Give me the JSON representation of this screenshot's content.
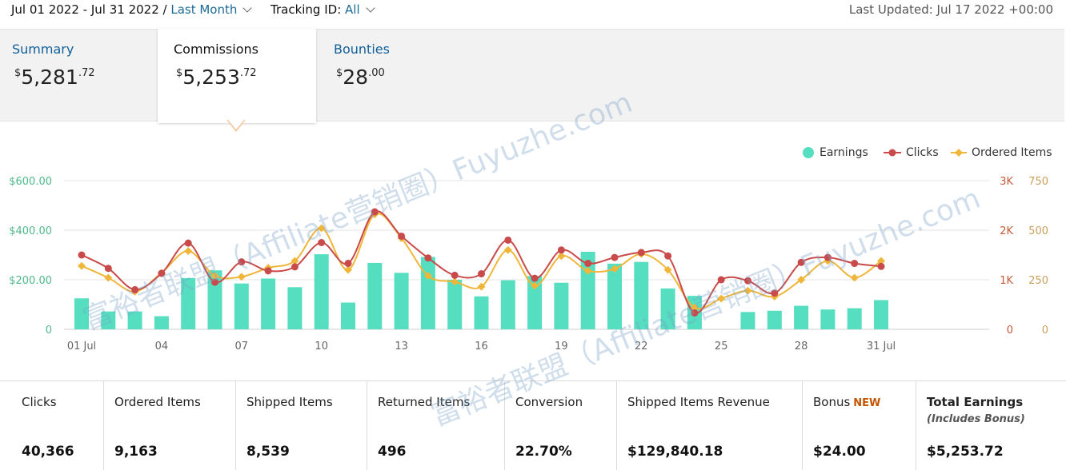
{
  "header": {
    "date_range": "Jul 01 2022 - Jul 31 2022 /",
    "period": "Last Month",
    "tracking_label": "Tracking ID:",
    "tracking_value": "All",
    "last_updated": "Last Updated: Jul 17 2022 +00:00"
  },
  "tabs": [
    {
      "name": "Summary",
      "currency": "$",
      "whole": "5,281",
      "cents": ".72"
    },
    {
      "name": "Commissions",
      "currency": "$",
      "whole": "5,253",
      "cents": ".72"
    },
    {
      "name": "Bounties",
      "currency": "$",
      "whole": "28",
      "cents": ".00"
    }
  ],
  "legend": {
    "earnings": "Earnings",
    "clicks": "Clicks",
    "ordered": "Ordered Items"
  },
  "colors": {
    "earnings": "#55dfc0",
    "clicks": "#c94a4a",
    "ordered": "#f0b63a",
    "axis_left": "#4fb98a",
    "axis_right1": "#c45a3a",
    "axis_right2": "#c9a060"
  },
  "chart_data": {
    "type": "bar",
    "x": [
      1,
      2,
      3,
      4,
      5,
      6,
      7,
      8,
      9,
      10,
      11,
      12,
      13,
      14,
      15,
      16,
      17,
      18,
      19,
      20,
      21,
      22,
      23,
      24,
      25,
      26,
      27,
      28,
      29,
      30,
      31
    ],
    "xtick_labels": [
      "01 Jul",
      "04",
      "07",
      "10",
      "13",
      "16",
      "19",
      "22",
      "25",
      "28",
      "31 Jul"
    ],
    "xtick_positions": [
      1,
      4,
      7,
      10,
      13,
      16,
      19,
      22,
      25,
      28,
      31
    ],
    "series": [
      {
        "name": "Earnings",
        "axis": "left",
        "type": "bar",
        "values": [
          125,
          72,
          72,
          53,
          207,
          238,
          185,
          205,
          170,
          303,
          108,
          268,
          228,
          292,
          200,
          133,
          198,
          215,
          188,
          313,
          265,
          272,
          165,
          135,
          0,
          70,
          75,
          95,
          80,
          85,
          118
        ]
      },
      {
        "name": "Clicks",
        "axis": "right1",
        "type": "line",
        "values": [
          1500,
          1230,
          800,
          1130,
          1740,
          950,
          1360,
          1180,
          1260,
          1750,
          1330,
          2370,
          1880,
          1440,
          1090,
          1120,
          1800,
          1030,
          1600,
          1330,
          1450,
          1550,
          1480,
          330,
          1000,
          980,
          730,
          1350,
          1450,
          1330,
          1270
        ]
      },
      {
        "name": "Ordered Items",
        "axis": "right2",
        "type": "line",
        "values": [
          320,
          260,
          190,
          285,
          395,
          270,
          265,
          310,
          345,
          510,
          300,
          580,
          460,
          270,
          240,
          215,
          400,
          220,
          370,
          295,
          305,
          380,
          300,
          110,
          155,
          195,
          165,
          250,
          345,
          260,
          345
        ]
      }
    ],
    "left_axis": {
      "ticks": [
        "0",
        "$200.00",
        "$400.00",
        "$600.00"
      ],
      "max": 600
    },
    "right1_axis": {
      "ticks": [
        "0",
        "1K",
        "2K",
        "3K"
      ],
      "max": 3000
    },
    "right2_axis": {
      "ticks": [
        "0",
        "250",
        "500",
        "750"
      ],
      "max": 750
    },
    "legend_position": "top-right",
    "grid": "horizontal"
  },
  "stats": [
    {
      "label": "Clicks",
      "value": "40,366"
    },
    {
      "label": "Ordered Items",
      "value": "9,163"
    },
    {
      "label": "Shipped Items",
      "value": "8,539"
    },
    {
      "label": "Returned Items",
      "value": "496"
    },
    {
      "label": "Conversion",
      "value": "22.70%"
    },
    {
      "label": "Shipped Items Revenue",
      "value": "$129,840.18"
    },
    {
      "label": "Bonus",
      "badge": "NEW",
      "value": "$24.00"
    },
    {
      "label": "Total Earnings",
      "sublabel": "(Includes Bonus)",
      "value": "$5,253.72"
    }
  ],
  "watermarks": [
    "富裕者联盟（Affiliate营销圈）Fuyuzhe.com",
    "富裕者联盟（Affiliate营销圈）Fuyuzhe.com"
  ]
}
